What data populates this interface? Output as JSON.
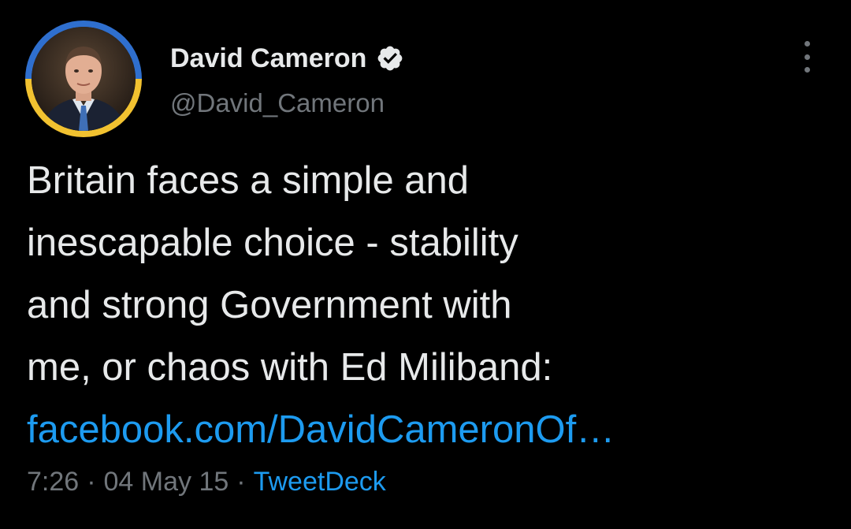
{
  "author": {
    "display_name": "David Cameron",
    "handle": "@David_Cameron",
    "verified": true,
    "avatar_ring_colors": [
      "#2f6fce",
      "#f2c230"
    ]
  },
  "tweet": {
    "lines": [
      "Britain faces a simple and",
      "inescapable choice - stability",
      "and strong Government with",
      "me, or chaos with Ed Miliband:"
    ],
    "link_text": "facebook.com/DavidCameronOf…",
    "time": "7:26",
    "date": "04 May 15",
    "separator": "·",
    "source": "TweetDeck"
  },
  "icons": {
    "verified": "verified-badge-icon",
    "more": "more-options-icon"
  },
  "colors": {
    "background": "#000000",
    "text": "#e7e9ea",
    "muted": "#71767b",
    "link": "#1d9bf0"
  }
}
